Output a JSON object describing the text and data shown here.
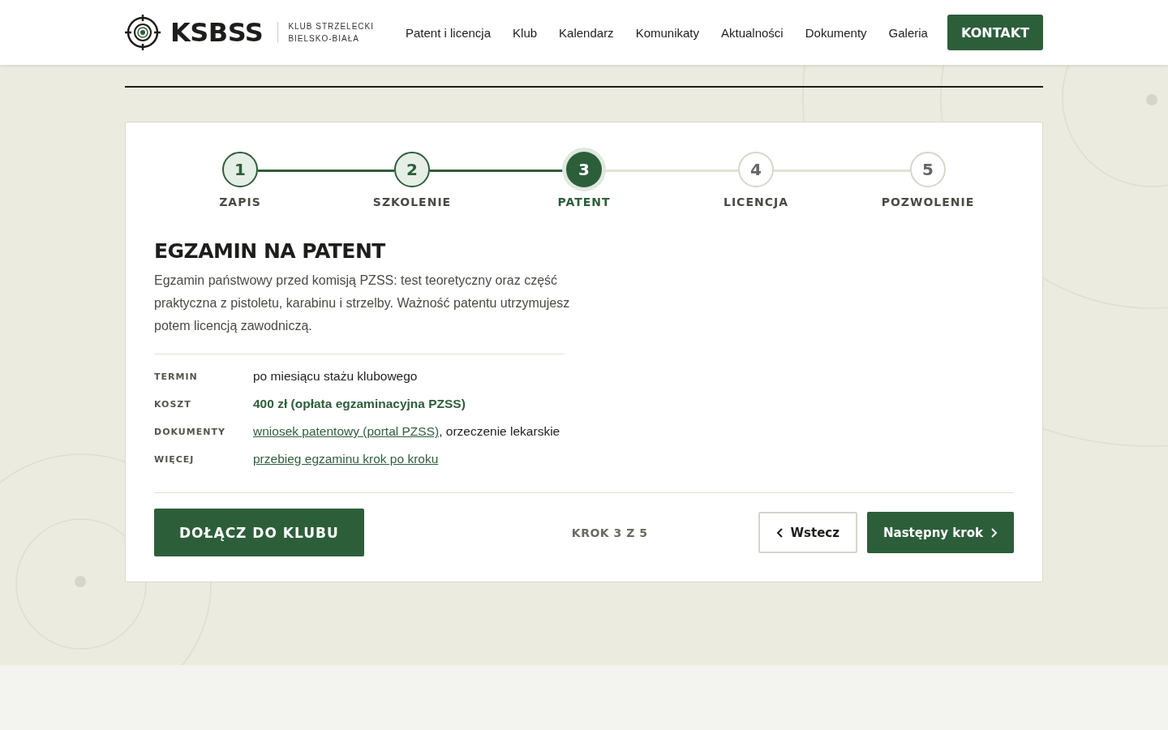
{
  "header": {
    "logo": {
      "name": "KSBSS",
      "tagline_1": "KLUB STRZELECKI",
      "tagline_2": "BIELSKO-BIAŁA"
    },
    "nav": [
      {
        "label": "Patent i licencja"
      },
      {
        "label": "Klub"
      },
      {
        "label": "Kalendarz"
      },
      {
        "label": "Komunikaty"
      },
      {
        "label": "Aktualności"
      },
      {
        "label": "Dokumenty"
      },
      {
        "label": "Galeria"
      }
    ],
    "cta": "KONTAKT"
  },
  "stepper": [
    {
      "number": "1",
      "label": "ZAPIS",
      "completed": true,
      "selected": false
    },
    {
      "number": "2",
      "label": "SZKOLENIE",
      "completed": true,
      "selected": false
    },
    {
      "number": "3",
      "label": "PATENT",
      "completed": false,
      "selected": true
    },
    {
      "number": "4",
      "label": "LICENCJA",
      "completed": false,
      "selected": false
    },
    {
      "number": "5",
      "label": "POZWOLENIE",
      "completed": false,
      "selected": false
    }
  ],
  "step": {
    "title": "EGZAMIN NA PATENT",
    "description": "Egzamin państwowy przed komisją PZSS: test teoretyczny oraz część praktyczna z pistoletu, karabinu i strzelby. Ważność patentu utrzymujesz potem licencją zawodniczą.",
    "details": [
      {
        "label": "TERMIN",
        "parts": [
          {
            "kind": "plain",
            "text": "po miesiącu stażu klubowego"
          }
        ]
      },
      {
        "label": "KOSZT",
        "parts": [
          {
            "kind": "strong",
            "text": "400 zł (opłata egzaminacyjna PZSS)"
          }
        ]
      },
      {
        "label": "DOKUMENTY",
        "parts": [
          {
            "kind": "link",
            "text": "wniosek patentowy (portal PZSS)"
          },
          {
            "kind": "plain",
            "text": ", orzeczenie lekarskie"
          }
        ]
      },
      {
        "label": "WIĘCEJ",
        "parts": [
          {
            "kind": "link",
            "text": "przebieg egzaminu krok po kroku"
          }
        ]
      }
    ]
  },
  "footer": {
    "join": "DOŁĄCZ DO KLUBU",
    "progress": "KROK 3 Z 5",
    "back": "Wstecz",
    "next": "Następny krok"
  }
}
